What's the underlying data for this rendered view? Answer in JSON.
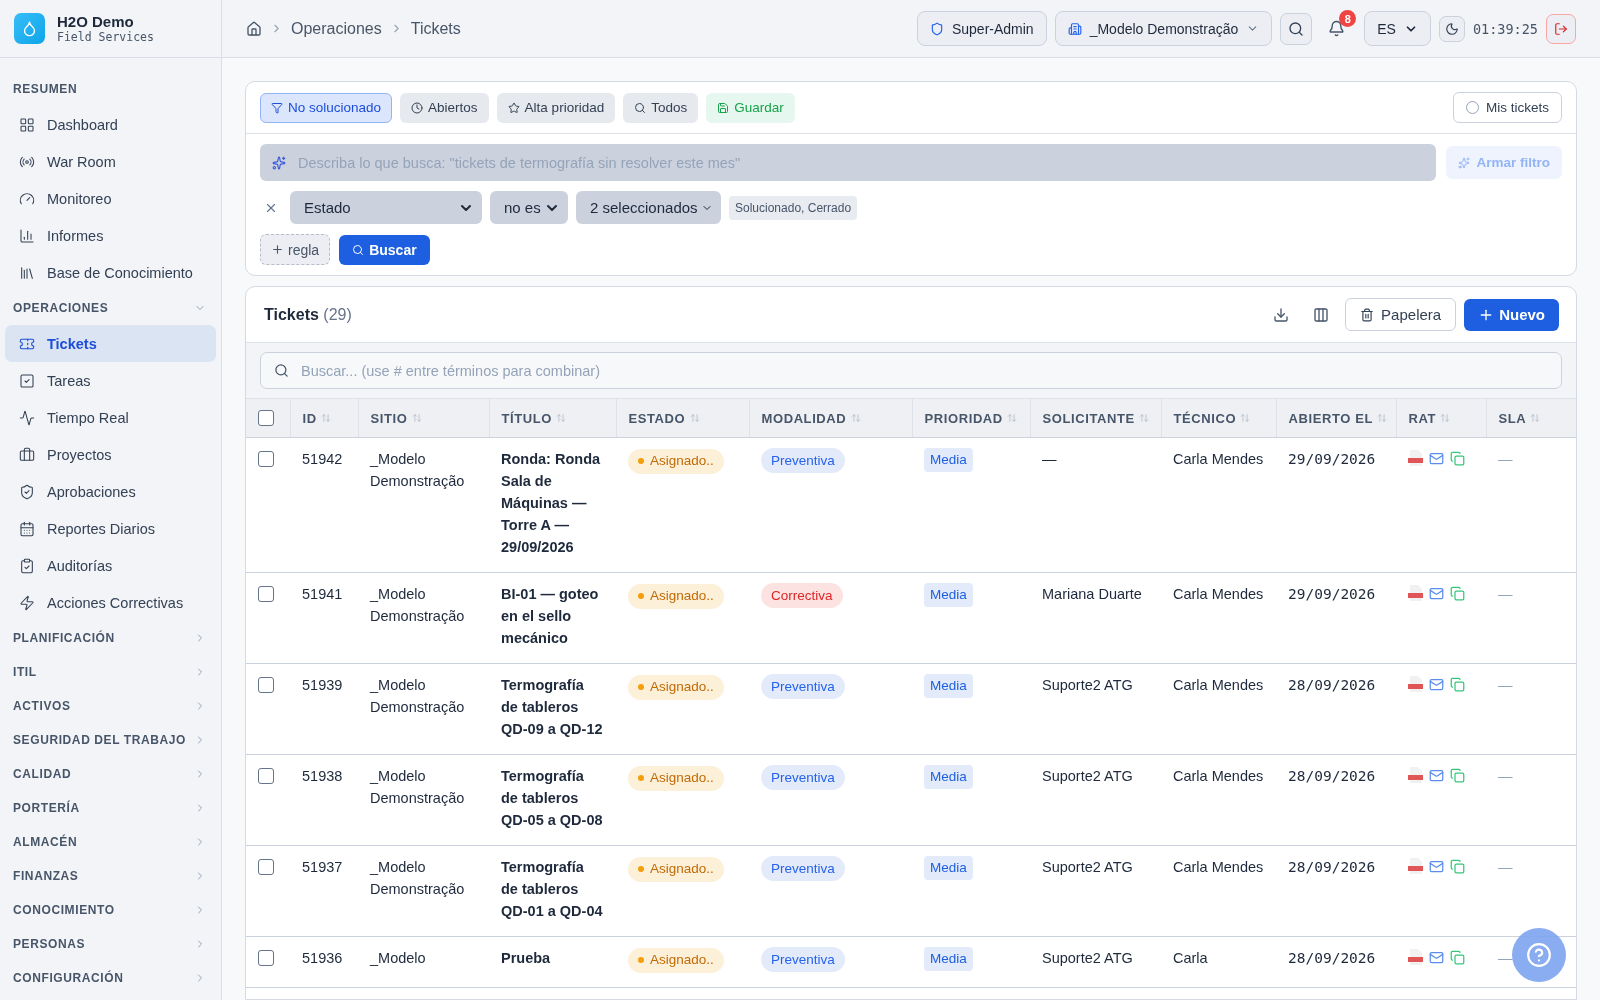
{
  "brand": {
    "name": "H2O Demo",
    "subtitle": "Field Services"
  },
  "sidebar": {
    "sections": [
      {
        "title": "RESUMEN",
        "kind": "heading",
        "items": [
          {
            "label": "Dashboard",
            "selected": false
          },
          {
            "label": "War Room",
            "selected": false
          },
          {
            "label": "Monitoreo",
            "selected": false
          },
          {
            "label": "Informes",
            "selected": false
          },
          {
            "label": "Base de Conocimiento",
            "selected": false
          }
        ]
      },
      {
        "title": "OPERACIONES",
        "kind": "group",
        "expanded": true,
        "items": [
          {
            "label": "Tickets",
            "selected": true
          },
          {
            "label": "Tareas",
            "selected": false
          },
          {
            "label": "Tiempo Real",
            "selected": false
          },
          {
            "label": "Proyectos",
            "selected": false
          },
          {
            "label": "Aprobaciones",
            "selected": false
          },
          {
            "label": "Reportes Diarios",
            "selected": false
          },
          {
            "label": "Auditorías",
            "selected": false
          },
          {
            "label": "Acciones Correctivas",
            "selected": false
          }
        ]
      },
      {
        "title": "PLANIFICACIÓN",
        "kind": "group",
        "expanded": false
      },
      {
        "title": "ITIL",
        "kind": "group",
        "expanded": false
      },
      {
        "title": "ACTIVOS",
        "kind": "group",
        "expanded": false
      },
      {
        "title": "SEGURIDAD DEL TRABAJO",
        "kind": "group",
        "expanded": false
      },
      {
        "title": "CALIDAD",
        "kind": "group",
        "expanded": false
      },
      {
        "title": "PORTERÍA",
        "kind": "group",
        "expanded": false
      },
      {
        "title": "ALMACÉN",
        "kind": "group",
        "expanded": false
      },
      {
        "title": "FINANZAS",
        "kind": "group",
        "expanded": false
      },
      {
        "title": "CONOCIMIENTO",
        "kind": "group",
        "expanded": false
      },
      {
        "title": "PERSONAS",
        "kind": "group",
        "expanded": false
      },
      {
        "title": "CONFIGURACIÓN",
        "kind": "group",
        "expanded": false
      }
    ]
  },
  "breadcrumb": [
    "Operaciones",
    "Tickets"
  ],
  "topbar": {
    "role": "Super-Admin",
    "site": "_Modelo Demonstração",
    "notifications": "8",
    "language": "ES",
    "clock": "01:39:25"
  },
  "filters": {
    "presets": [
      {
        "label": "No solucionado",
        "kind": "filter",
        "selected": true
      },
      {
        "label": "Abiertos",
        "kind": "clock",
        "selected": false
      },
      {
        "label": "Alta prioridad",
        "kind": "star",
        "selected": false
      },
      {
        "label": "Todos",
        "kind": "search",
        "selected": false
      },
      {
        "label": "Guardar",
        "kind": "save",
        "selected": false
      }
    ],
    "mine": {
      "label": "Mis tickets",
      "checked": false
    },
    "ai_query": {
      "placeholder": "Describa lo que busca: \"tickets de termografía sin resolver este mes\""
    },
    "ai_button": {
      "label": "Armar filtro",
      "disabled": true
    },
    "rule": {
      "field": "Estado",
      "operator": "no es",
      "values": "2 seleccionados",
      "summary": "Solucionado, Cerrado"
    },
    "add_rule": "regla",
    "search": "Buscar"
  },
  "list": {
    "title": "Tickets",
    "count": "(29)",
    "trash": "Papelera",
    "new": "Nuevo",
    "search": {
      "placeholder": "Buscar... (use # entre términos para combinar)"
    },
    "all_checked": false,
    "columns": [
      "ID",
      "SITIO",
      "TÍTULO",
      "ESTADO",
      "MODALIDAD",
      "PRIORIDAD",
      "SOLICITANTE",
      "TÉCNICO",
      "ABIERTO EL",
      "RAT",
      "SLA"
    ],
    "rows": [
      {
        "id": "51942",
        "site": "_Modelo Demonstração",
        "title": "Ronda: Ronda Sala de Máquinas — Torre A — 29/09/2026",
        "status": "Asignado..",
        "modality": "Preventiva",
        "kind": "preventive",
        "priority": "Media",
        "requester": "—",
        "technician": "Carla Mendes",
        "opened": "29/09/2026",
        "sla": "—",
        "checked": false
      },
      {
        "id": "51941",
        "site": "_Modelo Demonstração",
        "title": "BI-01 — goteo en el sello mecánico",
        "status": "Asignado..",
        "modality": "Correctiva",
        "kind": "corrective",
        "priority": "Media",
        "requester": "Mariana Duarte",
        "technician": "Carla Mendes",
        "opened": "29/09/2026",
        "sla": "—",
        "checked": false
      },
      {
        "id": "51939",
        "site": "_Modelo Demonstração",
        "title": "Termografía de tableros QD-09 a QD-12",
        "status": "Asignado..",
        "modality": "Preventiva",
        "kind": "preventive",
        "priority": "Media",
        "requester": "Suporte2 ATG",
        "technician": "Carla Mendes",
        "opened": "28/09/2026",
        "sla": "—",
        "checked": false
      },
      {
        "id": "51938",
        "site": "_Modelo Demonstração",
        "title": "Termografía de tableros QD-05 a QD-08",
        "status": "Asignado..",
        "modality": "Preventiva",
        "kind": "preventive",
        "priority": "Media",
        "requester": "Suporte2 ATG",
        "technician": "Carla Mendes",
        "opened": "28/09/2026",
        "sla": "—",
        "checked": false
      },
      {
        "id": "51937",
        "site": "_Modelo Demonstração",
        "title": "Termografía de tableros QD-01 a QD-04",
        "status": "Asignado..",
        "modality": "Preventiva",
        "kind": "preventive",
        "priority": "Media",
        "requester": "Suporte2 ATG",
        "technician": "Carla Mendes",
        "opened": "28/09/2026",
        "sla": "—",
        "checked": false
      },
      {
        "id": "51936",
        "site": "_Modelo",
        "title": "Prueba",
        "status": "Asignado..",
        "modality": "Preventiva",
        "kind": "preventive",
        "priority": "Media",
        "requester": "Suporte2 ATG",
        "technician": "Carla",
        "opened": "28/09/2026",
        "sla": "—",
        "checked": false
      }
    ]
  }
}
